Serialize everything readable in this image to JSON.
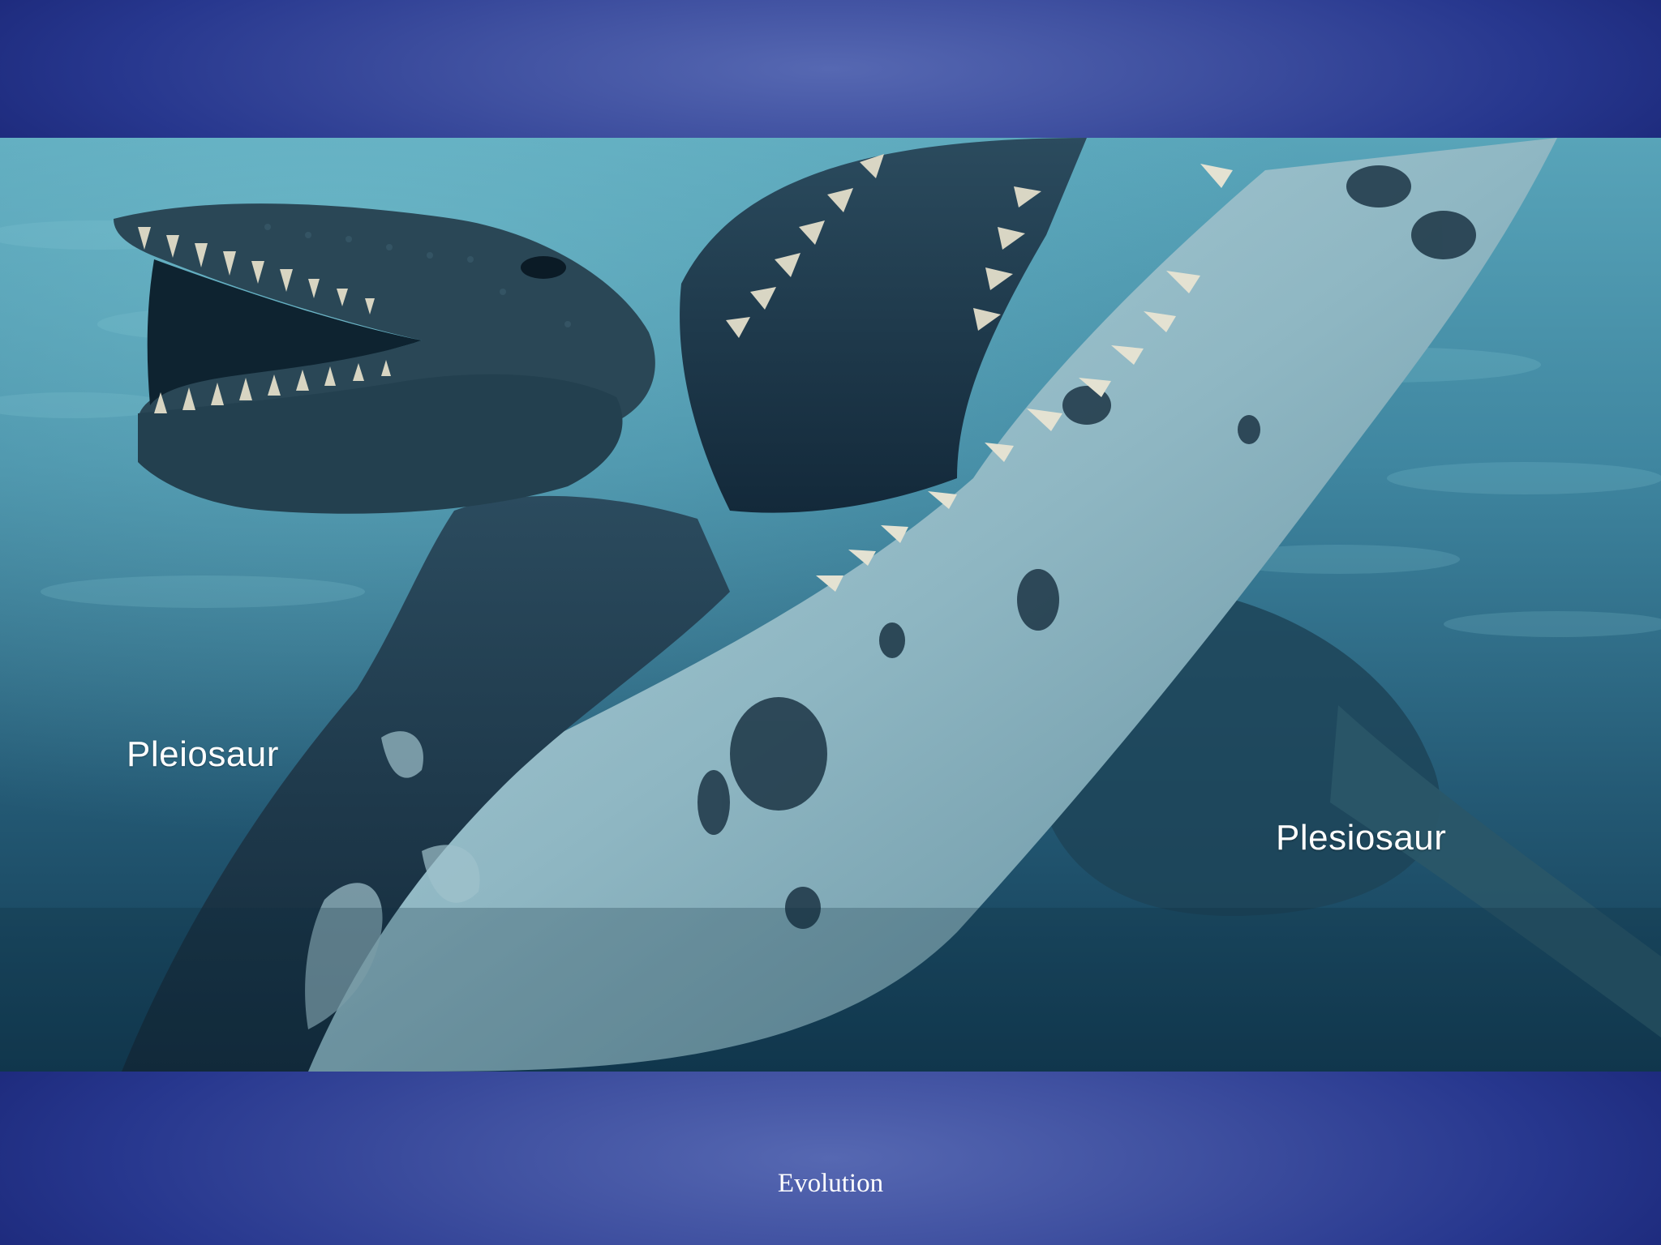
{
  "slide": {
    "labels": {
      "pleiosaur": "Pleiosaur",
      "plesiosaur": "Plesiosaur"
    },
    "footer": "Evolution"
  },
  "colors": {
    "band_center": "#5668b2",
    "band_edge": "#1d2a7c",
    "water_light": "#4f97ad",
    "water_deep": "#123a52",
    "creature_dark": "#1d3a4d",
    "creature_light": "#a9c9d3",
    "text": "#ffffff"
  },
  "image": {
    "subject": "underwater-marine-reptiles",
    "icon": "photo-icon"
  }
}
